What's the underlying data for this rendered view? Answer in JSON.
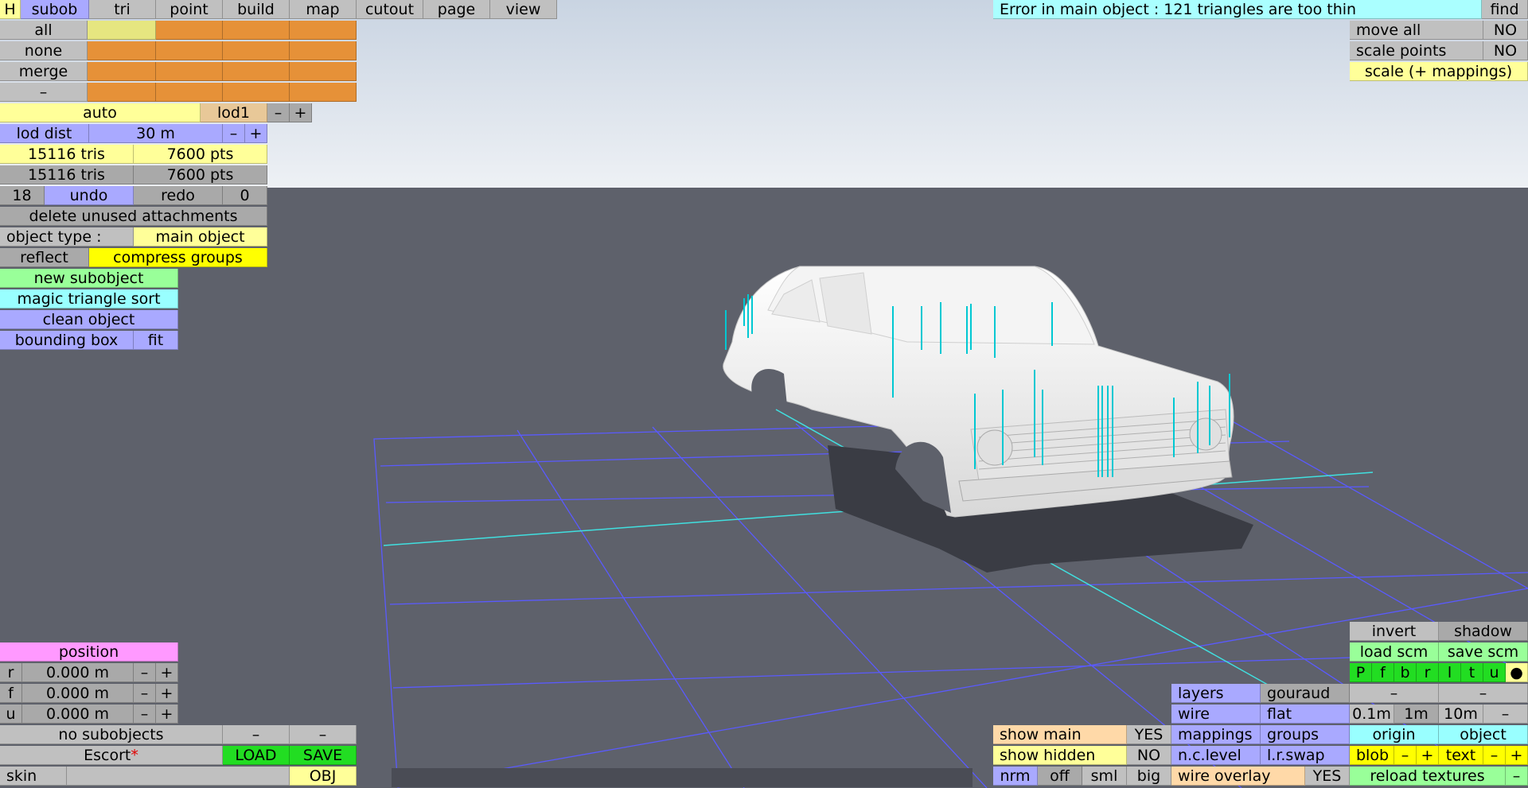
{
  "menu": {
    "h": "H",
    "tabs": [
      "subob",
      "tri",
      "point",
      "build",
      "map",
      "cutout",
      "page",
      "view"
    ]
  },
  "error_message": "Error in main object : 121 triangles are too thin",
  "find": "find",
  "select_rows": [
    "all",
    "none",
    "merge",
    "–"
  ],
  "lod": {
    "auto": "auto",
    "name": "lod1",
    "minus": "–",
    "plus": "+"
  },
  "lod_dist": {
    "label": "lod dist",
    "value": "30 m",
    "minus": "–",
    "plus": "+"
  },
  "counts": [
    {
      "tris": "15116 tris",
      "pts": "7600 pts"
    },
    {
      "tris": "15116 tris",
      "pts": "7600 pts"
    }
  ],
  "undo_row": {
    "undo_count": "18",
    "undo": "undo",
    "redo": "redo",
    "redo_count": "0"
  },
  "delete_unused": "delete unused attachments",
  "object_type": {
    "label": "object type :",
    "value": "main object"
  },
  "reflect": "reflect",
  "compress_groups": "compress groups",
  "new_subobject": "new subobject",
  "magic_sort": "magic triangle sort",
  "clean_object": "clean object",
  "bounding_box": "bounding box",
  "fit": "fit",
  "top_right": {
    "move_all": "move all",
    "move_all_val": "NO",
    "scale_points": "scale points",
    "scale_points_val": "NO",
    "scale_mappings": "scale (+ mappings)"
  },
  "position": {
    "title": "position",
    "rows": [
      {
        "axis": "r",
        "value": "0.000 m"
      },
      {
        "axis": "f",
        "value": "0.000 m"
      },
      {
        "axis": "u",
        "value": "0.000 m"
      }
    ],
    "minus": "–",
    "plus": "+"
  },
  "bottom_left": {
    "no_subobjects": "no subobjects",
    "dash1": "–",
    "dash2": "–",
    "name": "Escort",
    "star": "*",
    "load": "LOAD",
    "save": "SAVE",
    "skin": "skin",
    "obj": "OBJ"
  },
  "bottom_mid": {
    "show_main": "show main",
    "show_main_val": "YES",
    "show_hidden": "show hidden",
    "show_hidden_val": "NO",
    "nrm": "nrm",
    "off": "off",
    "sml": "sml",
    "big": "big"
  },
  "render_modes": {
    "layers": "layers",
    "gouraud": "gouraud",
    "wire": "wire",
    "flat": "flat",
    "mappings": "mappings",
    "groups": "groups",
    "nclevel": "n.c.level",
    "lrswap": "l.r.swap",
    "wire_overlay": "wire overlay",
    "wire_overlay_val": "YES"
  },
  "bottom_right": {
    "invert": "invert",
    "shadow": "shadow",
    "load_scm": "load scm",
    "save_scm": "save scm",
    "views": [
      "P",
      "f",
      "b",
      "r",
      "l",
      "t",
      "u",
      "●"
    ],
    "dash_a": "–",
    "dash_b": "–",
    "grid": [
      "0.1m",
      "1m",
      "10m",
      "–"
    ],
    "origin": "origin",
    "object": "object",
    "blob": "blob",
    "blob_minus": "–",
    "blob_plus": "+",
    "text": "text",
    "text_minus": "–",
    "text_plus": "+",
    "reload_textures": "reload textures",
    "reload_minus": "–"
  },
  "colors": {
    "sky": "#dfe6ee",
    "ground": "#5e616b",
    "grid_line": "#5a5aff",
    "axis_line": "#40e0e0",
    "car": "#f2f2f2"
  }
}
